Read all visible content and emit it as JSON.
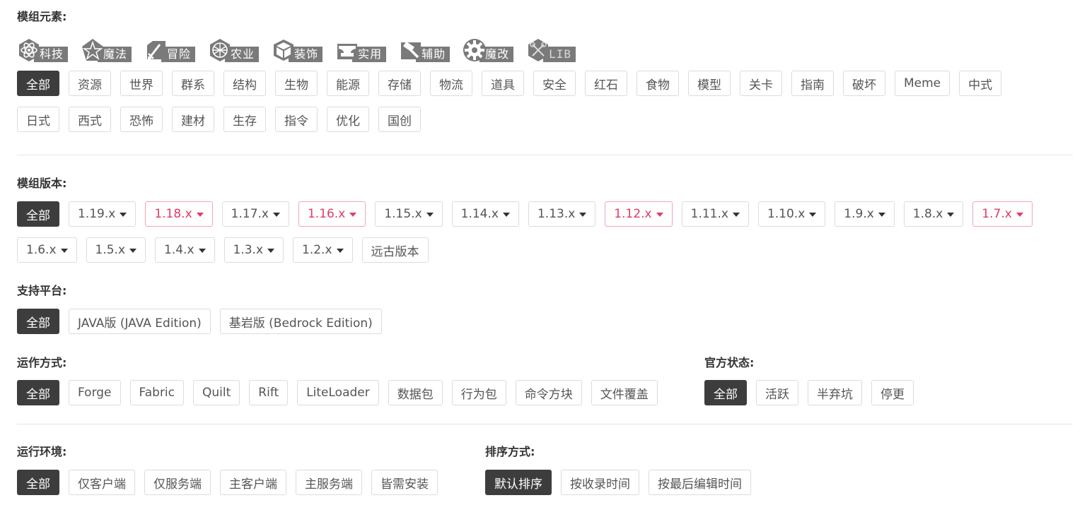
{
  "elements": {
    "label": "模组元素:",
    "categories": [
      {
        "label": "科技",
        "icon": "atom-icon"
      },
      {
        "label": "魔法",
        "icon": "pentagram-icon"
      },
      {
        "label": "冒险",
        "icon": "sword-icon"
      },
      {
        "label": "农业",
        "icon": "wheat-ball-icon"
      },
      {
        "label": "装饰",
        "icon": "cube-icon"
      },
      {
        "label": "实用",
        "icon": "anvil-icon"
      },
      {
        "label": "辅助",
        "icon": "hammer-icon"
      },
      {
        "label": "魔改",
        "icon": "gear-icon"
      },
      {
        "label": "LIB",
        "icon": "tools-icon"
      }
    ],
    "tags_row1": [
      "全部",
      "资源",
      "世界",
      "群系",
      "结构",
      "生物",
      "能源",
      "存储",
      "物流",
      "道具",
      "安全",
      "红石",
      "食物",
      "模型",
      "关卡",
      "指南",
      "破坏",
      "Meme",
      "中式"
    ],
    "tags_row2": [
      "日式",
      "西式",
      "恐怖",
      "建材",
      "生存",
      "指令",
      "优化",
      "国创"
    ]
  },
  "versions": {
    "label": "模组版本:",
    "row1": [
      {
        "label": "全部",
        "active": true
      },
      {
        "label": "1.19.x"
      },
      {
        "label": "1.18.x",
        "pink": true
      },
      {
        "label": "1.17.x"
      },
      {
        "label": "1.16.x",
        "pink": true
      },
      {
        "label": "1.15.x"
      },
      {
        "label": "1.14.x"
      },
      {
        "label": "1.13.x"
      },
      {
        "label": "1.12.x",
        "pink": true
      },
      {
        "label": "1.11.x"
      },
      {
        "label": "1.10.x"
      },
      {
        "label": "1.9.x"
      },
      {
        "label": "1.8.x"
      },
      {
        "label": "1.7.x",
        "pink": true
      }
    ],
    "row2": [
      {
        "label": "1.6.x"
      },
      {
        "label": "1.5.x"
      },
      {
        "label": "1.4.x"
      },
      {
        "label": "1.3.x"
      },
      {
        "label": "1.2.x"
      },
      {
        "label": "远古版本",
        "nocaret": true
      }
    ]
  },
  "platform": {
    "label": "支持平台:",
    "options": [
      "全部",
      "JAVA版 (JAVA Edition)",
      "基岩版 (Bedrock Edition)"
    ]
  },
  "runmode": {
    "label": "运作方式:",
    "options": [
      "全部",
      "Forge",
      "Fabric",
      "Quilt",
      "Rift",
      "LiteLoader",
      "数据包",
      "行为包",
      "命令方块",
      "文件覆盖"
    ]
  },
  "status": {
    "label": "官方状态:",
    "options": [
      "全部",
      "活跃",
      "半弃坑",
      "停更"
    ]
  },
  "environment": {
    "label": "运行环境:",
    "options": [
      "全部",
      "仅客户端",
      "仅服务端",
      "主客户端",
      "主服务端",
      "皆需安装"
    ]
  },
  "sort": {
    "label": "排序方式:",
    "options": [
      "默认排序",
      "按收录时间",
      "按最后编辑时间"
    ]
  }
}
